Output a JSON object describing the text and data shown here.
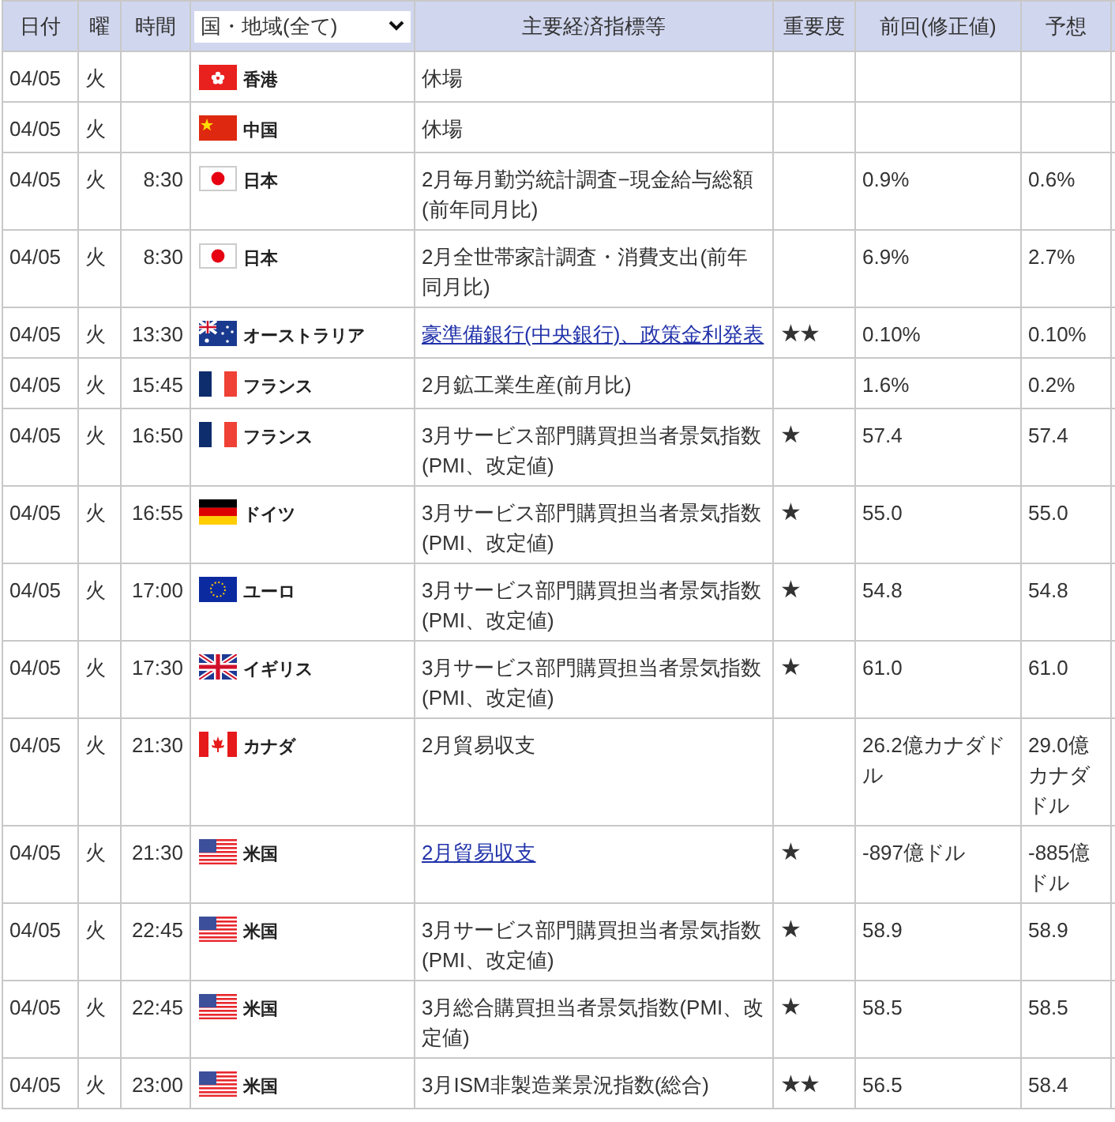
{
  "table": {
    "columns": [
      "日付",
      "曜",
      "時間",
      "国・地域(全て)",
      "主要経済指標等",
      "重要度",
      "前回(修正値)",
      "予想"
    ],
    "rows": [
      {
        "date": "04/05",
        "weekday": "火",
        "time": "",
        "country": "香港",
        "kind": "hk",
        "indicator": "休場",
        "link": false,
        "previous": "",
        "forecast": ""
      },
      {
        "date": "04/05",
        "weekday": "火",
        "time": "",
        "country": "中国",
        "kind": "cn",
        "indicator": "休場",
        "link": false,
        "previous": "",
        "forecast": ""
      },
      {
        "date": "04/05",
        "weekday": "火",
        "time": "8:30",
        "country": "日本",
        "kind": "jp",
        "indicator": "2月毎月勤労統計調査−現金給与総額(前年同月比)",
        "link": false,
        "previous": "0.9%",
        "forecast": "0.6%"
      },
      {
        "date": "04/05",
        "weekday": "火",
        "time": "8:30",
        "country": "日本",
        "kind": "jp",
        "indicator": "2月全世帯家計調査・消費支出(前年同月比)",
        "link": false,
        "previous": "6.9%",
        "forecast": "2.7%"
      },
      {
        "date": "04/05",
        "weekday": "火",
        "time": "13:30",
        "country": "オーストラリア",
        "kind": "au",
        "indicator": "豪準備銀行(中央銀行)、政策金利発表",
        "link": true,
        "importance": "★★",
        "previous": "0.10%",
        "forecast": "0.10%"
      },
      {
        "date": "04/05",
        "weekday": "火",
        "time": "15:45",
        "country": "フランス",
        "kind": "fr",
        "indicator": "2月鉱工業生産(前月比)",
        "link": false,
        "previous": "1.6%",
        "forecast": "0.2%"
      },
      {
        "date": "04/05",
        "weekday": "火",
        "time": "16:50",
        "country": "フランス",
        "kind": "fr",
        "indicator": "3月サービス部門購買担当者景気指数(PMI、改定値)",
        "link": false,
        "importance": "★",
        "previous": "57.4",
        "forecast": "57.4"
      },
      {
        "date": "04/05",
        "weekday": "火",
        "time": "16:55",
        "country": "ドイツ",
        "kind": "de",
        "indicator": "3月サービス部門購買担当者景気指数(PMI、改定値)",
        "link": false,
        "importance": "★",
        "previous": "55.0",
        "forecast": "55.0"
      },
      {
        "date": "04/05",
        "weekday": "火",
        "time": "17:00",
        "country": "ユーロ",
        "kind": "eu",
        "indicator": "3月サービス部門購買担当者景気指数(PMI、改定値)",
        "link": false,
        "importance": "★",
        "previous": "54.8",
        "forecast": "54.8"
      },
      {
        "date": "04/05",
        "weekday": "火",
        "time": "17:30",
        "country": "イギリス",
        "kind": "gb",
        "indicator": "3月サービス部門購買担当者景気指数(PMI、改定値)",
        "link": false,
        "importance": "★",
        "previous": "61.0",
        "forecast": "61.0"
      },
      {
        "date": "04/05",
        "weekday": "火",
        "time": "21:30",
        "country": "カナダ",
        "kind": "ca",
        "indicator": "2月貿易収支",
        "link": false,
        "previous": "26.2億カナダドル",
        "forecast": "29.0億カナダドル"
      },
      {
        "date": "04/05",
        "weekday": "火",
        "time": "21:30",
        "country": "米国",
        "kind": "us",
        "indicator": "2月貿易収支",
        "link": true,
        "importance": "★",
        "previous": "-897億ドル",
        "forecast": "-885億ドル"
      },
      {
        "date": "04/05",
        "weekday": "火",
        "time": "22:45",
        "country": "米国",
        "kind": "us",
        "indicator": "3月サービス部門購買担当者景気指数(PMI、改定値)",
        "link": false,
        "importance": "★",
        "previous": "58.9",
        "forecast": "58.9"
      },
      {
        "date": "04/05",
        "weekday": "火",
        "time": "22:45",
        "country": "米国",
        "kind": "us",
        "indicator": "3月総合購買担当者景気指数(PMI、改定値)",
        "link": false,
        "importance": "★",
        "previous": "58.5",
        "forecast": "58.5"
      },
      {
        "date": "04/05",
        "weekday": "火",
        "time": "23:00",
        "country": "米国",
        "kind": "us",
        "indicator": "3月ISM非製造業景況指数(総合)",
        "link": false,
        "importance": "★★",
        "previous": "56.5",
        "forecast": "58.4"
      }
    ]
  }
}
